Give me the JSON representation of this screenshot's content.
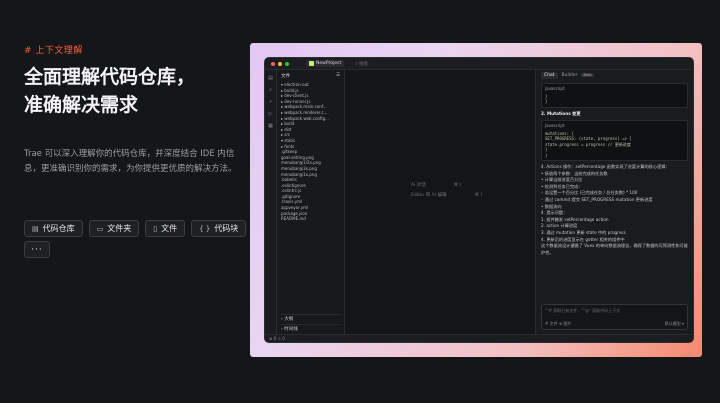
{
  "section_tag": "# 上下文理解",
  "headline": "全面理解代码仓库，\n准确解决需求",
  "description": "Trae 可以深入理解你的代码仓库，并深度结合 IDE 内信息，更准确识别你的需求，为你提供更优质的解决方法。",
  "chips": [
    {
      "icon": "▤",
      "label": "代码仓库"
    },
    {
      "icon": "▭",
      "label": "文件夹"
    },
    {
      "icon": "▯",
      "label": "文件"
    },
    {
      "icon": "{ }",
      "label": "代码块"
    }
  ],
  "more_label": "···",
  "ide": {
    "project_name": "NewProject",
    "search_placeholder": "搜索",
    "explorer_title": "文件",
    "tree": [
      "▾ electron-out",
      "  ▸ build.js",
      "  ▸ dev-client.js",
      "  ▸ dev-runner.js",
      "  ▸ webpack.main.conf...",
      "  ▸ webpack.renderer.c...",
      "  ▸ webpack.web.config...",
      "▸ build",
      "▸ dist",
      "▸ src",
      "▾ static",
      "  ▸ fonts",
      "  .gitkeep",
      "  goal-setting.png",
      "  menubar@1/2x.png",
      "  menubar@3x.png",
      "  menubar@1x.png",
      "  .babelrc",
      "  .eslintignore",
      "  .eslintrc.js",
      "  .gitignore",
      "  .travis.yml",
      "  appveyor.yml",
      "  package.json",
      "  README.md"
    ],
    "collapsed": [
      "大纲",
      "时间线"
    ],
    "editor_hint": [
      {
        "label": "Ai 对话",
        "key": "⌘ I"
      },
      {
        "label": "Editor 和 AI 编辑",
        "key": "⌘ I"
      }
    ],
    "chat_tabs": {
      "chat": "Chat",
      "builder": "Builder",
      "beta": "Beta"
    },
    "code1": {
      "lang": "javascript",
      "lines": [
        "}",
        "}"
      ]
    },
    "section2": "2. Mutations 变更",
    "code2": {
      "lang": "javascript",
      "lines": [
        "mutations: {",
        "  SET_PROGRESS: (state, progress) => {",
        "    state.progress = progress  // 更新进度",
        "  }",
        "}"
      ]
    },
    "msg": [
      "4. Actions 操作：setPercentage 函数实现了进度计算的核心逻辑：",
      "• 接收两个参数：当前完成的任务数",
      "• 计算当前进度百分比",
      "• 检测到任务已完成：",
      "   ◦ 若设置一个百分比 (已完成任务 / 总任务数) * 100",
      "   ◦ 通过 commit 提交 SET_PROGRESS mutation 更新进度",
      "• 数据流向",
      "4. 提示问题：",
      "1. 组件触发 setPercentage action",
      "2. action 计算进度",
      "3. 通过 mutation 更新 state 中的 progress",
      "4. 更新后的进度显示在 getter 相关的组件中",
      "这个数据流设计遵循了 Vuex 的单向数据流理念，确保了数据的可预测性和可维护性。"
    ],
    "input_placeholder": "\"\"# 获取已有文件，\"\"@\" 获取代码上下文",
    "input_left": "# 文件  ⊕ 图片",
    "input_right": "默认模型 ▾",
    "status": "⊗ 0 ⚠ 0"
  },
  "colors": {
    "accent": "#ff5e3a",
    "page_bg": "#151618"
  }
}
